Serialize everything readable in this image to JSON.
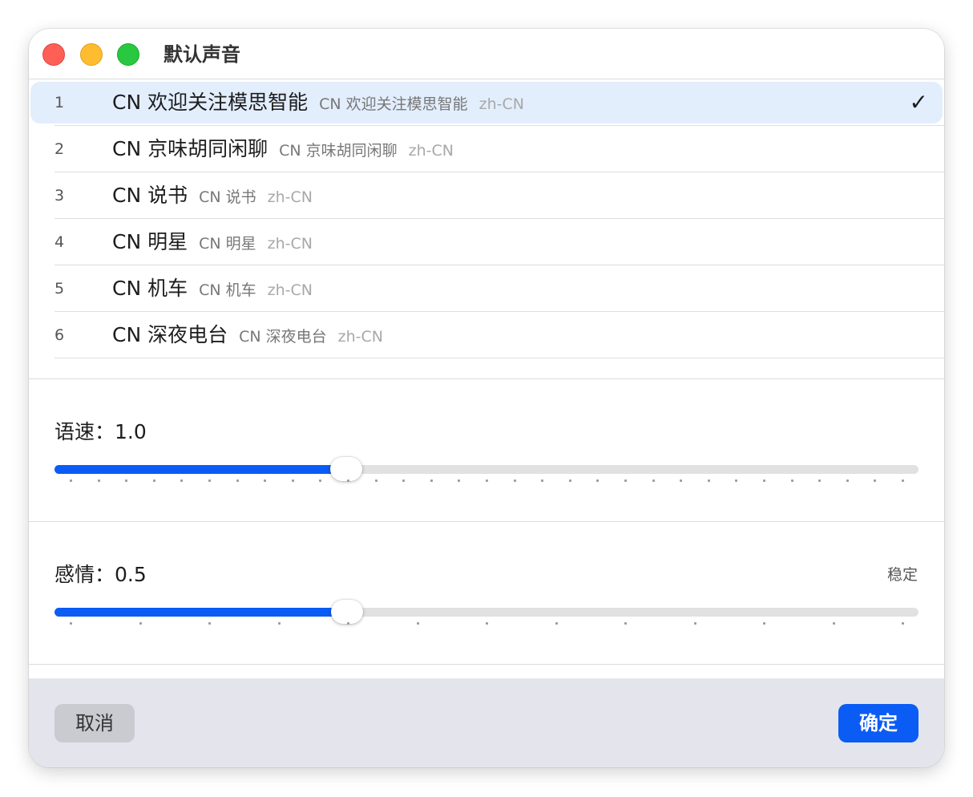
{
  "window": {
    "title": "默认声音"
  },
  "voices": [
    {
      "index": "1",
      "name": "CN 欢迎关注模思智能",
      "subtitle": "CN 欢迎关注模思智能",
      "lang": "zh-CN",
      "selected": true
    },
    {
      "index": "2",
      "name": "CN 京味胡同闲聊",
      "subtitle": "CN 京味胡同闲聊",
      "lang": "zh-CN",
      "selected": false
    },
    {
      "index": "3",
      "name": "CN 说书",
      "subtitle": "CN 说书",
      "lang": "zh-CN",
      "selected": false
    },
    {
      "index": "4",
      "name": "CN 明星",
      "subtitle": "CN 明星",
      "lang": "zh-CN",
      "selected": false
    },
    {
      "index": "5",
      "name": "CN 机车",
      "subtitle": "CN 机车",
      "lang": "zh-CN",
      "selected": false
    },
    {
      "index": "6",
      "name": "CN 深夜电台",
      "subtitle": "CN 深夜电台",
      "lang": "zh-CN",
      "selected": false
    }
  ],
  "check_mark": "✓",
  "speed": {
    "label": "语速：1.0",
    "fraction": 0.338,
    "tick_count": 31
  },
  "emotion": {
    "label": "感情：0.5",
    "right_label": "稳定",
    "fraction": 0.339,
    "tick_count": 13
  },
  "footer": {
    "cancel_label": "取消",
    "ok_label": "确定"
  },
  "colors": {
    "accent": "#0b5cf5",
    "selected_row": "#e3eefd",
    "footer_bg": "#e4e5ec"
  }
}
